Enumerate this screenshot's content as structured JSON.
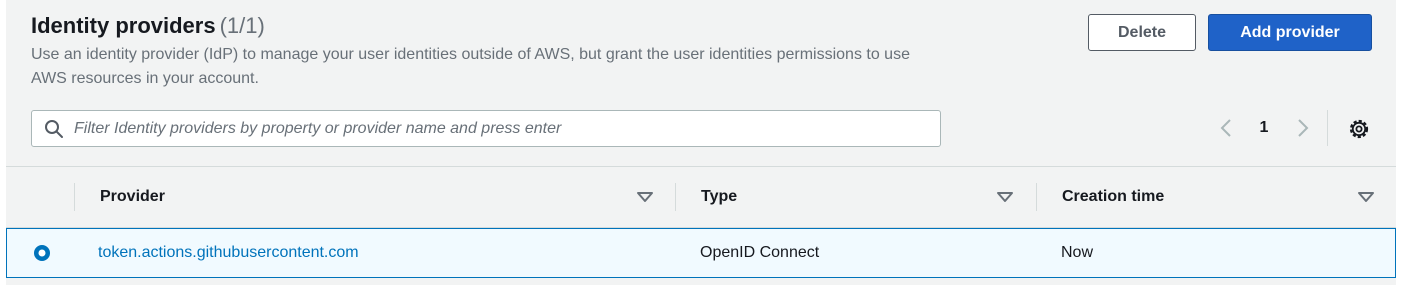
{
  "header": {
    "title": "Identity providers",
    "count": "(1/1)",
    "description": "Use an identity provider (IdP) to manage your user identities outside of AWS, but grant the user identities permissions to use AWS resources in your account."
  },
  "buttons": {
    "delete_label": "Delete",
    "add_label": "Add provider"
  },
  "search": {
    "placeholder": "Filter Identity providers by property or provider name and press enter",
    "value": ""
  },
  "pagination": {
    "current_page": "1"
  },
  "table": {
    "columns": [
      "Provider",
      "Type",
      "Creation time"
    ],
    "rows": [
      {
        "selected": true,
        "provider": "token.actions.githubusercontent.com",
        "type": "OpenID Connect",
        "creation_time": "Now"
      }
    ]
  },
  "colors": {
    "primary": "#1f62c8",
    "link": "#0073bb",
    "selected_row_bg": "#f1faff"
  },
  "icons": {
    "search": "search-icon",
    "prev": "chevron-left-icon",
    "next": "chevron-right-icon",
    "settings": "gear-icon",
    "sort": "caret-down-icon",
    "radio": "radio-selected-icon"
  }
}
